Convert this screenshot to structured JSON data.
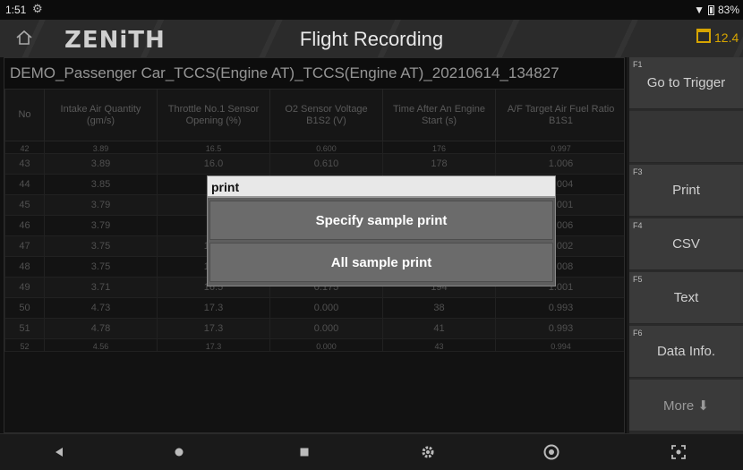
{
  "status": {
    "time": "1:51",
    "battery": "83%"
  },
  "header": {
    "title": "Flight Recording",
    "logo": "ZENiTH",
    "calendar_label": "12.4"
  },
  "panel": {
    "filename": "DEMO_Passenger Car_TCCS(Engine AT)_TCCS(Engine AT)_20210614_134827",
    "columns": [
      "No",
      "Intake Air Quantity (gm/s)",
      "Throttle No.1 Sensor Opening (%)",
      "O2 Sensor Voltage B1S2 (V)",
      "Time After An Engine Start (s)",
      "A/F Target Air Fuel Ratio B1S1"
    ],
    "partial_top": [
      "42",
      "3.89",
      "16.5",
      "0.600",
      "176",
      "0.997"
    ],
    "rows": [
      [
        "43",
        "3.89",
        "16.0",
        "0.610",
        "178",
        "1.006"
      ],
      [
        "44",
        "3.85",
        "",
        "",
        "",
        "1.004"
      ],
      [
        "45",
        "3.79",
        "",
        "",
        "",
        "1.001"
      ],
      [
        "46",
        "3.79",
        "",
        "",
        "",
        "1.006"
      ],
      [
        "47",
        "3.75",
        "16.5",
        "0.310",
        "188",
        "1.002"
      ],
      [
        "48",
        "3.75",
        "16.5",
        "0.250",
        "191",
        "1.008"
      ],
      [
        "49",
        "3.71",
        "16.5",
        "0.175",
        "194",
        "1.001"
      ],
      [
        "50",
        "4.73",
        "17.3",
        "0.000",
        "38",
        "0.993"
      ],
      [
        "51",
        "4.78",
        "17.3",
        "0.000",
        "41",
        "0.993"
      ]
    ],
    "partial_bottom": [
      "52",
      "4.56",
      "17.3",
      "0.000",
      "43",
      "0.994"
    ]
  },
  "fkeys": [
    {
      "key": "F1",
      "label": "Go to Trigger"
    },
    {
      "key": "",
      "label": ""
    },
    {
      "key": "F3",
      "label": "Print"
    },
    {
      "key": "F4",
      "label": "CSV"
    },
    {
      "key": "F5",
      "label": "Text"
    },
    {
      "key": "F6",
      "label": "Data Info."
    },
    {
      "key": "",
      "label": "More ⬇"
    }
  ],
  "dialog": {
    "title": "print",
    "specify": "Specify sample print",
    "all": "All sample print"
  },
  "colors": {
    "accent": "#d6a400",
    "dialog_bg": "#5e5e5e"
  }
}
